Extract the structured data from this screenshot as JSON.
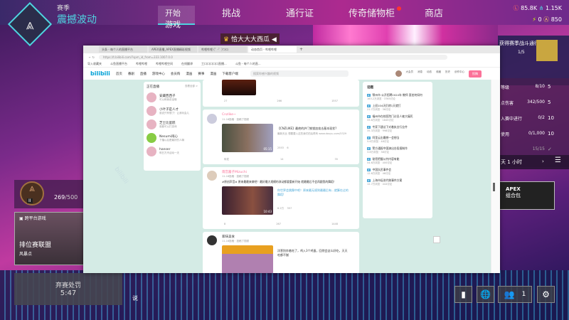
{
  "game": {
    "season_label": "赛季",
    "season_name": "震撼波动",
    "nav": [
      "开始游戏",
      "挑战",
      "通行证",
      "传奇储物柜",
      "商店"
    ],
    "currency": {
      "legend_tokens": "85.8K",
      "crafting": "1.15K",
      "apex_coins": "0",
      "gold": "850"
    },
    "player_name": "恰大大大西瓜",
    "battlepass": {
      "title": "获得赛季战斗通行证",
      "progress": "1/5"
    },
    "challenges": [
      {
        "label": "等级",
        "value": "8/10",
        "reward": "5"
      },
      {
        "label": "点伤害",
        "value": "342/500",
        "reward": "5"
      },
      {
        "label": "入赛中进行",
        "value": "0/2",
        "reward": "10"
      },
      {
        "label": "使用",
        "value": "0/1,000",
        "reward": "10"
      },
      {
        "label": "",
        "value": "15/15",
        "reward": "✓"
      }
    ],
    "challenge_timer": "天 1 小时",
    "promo": {
      "title": "APEX",
      "subtitle": "组合包"
    },
    "rank": {
      "tier": "II",
      "points": "269",
      "max": "/500"
    },
    "mode": {
      "tag": "跨平台游戏",
      "name": "排位赛联盟",
      "map": "风暴点"
    },
    "penalty": {
      "label": "弃赛处罚",
      "timer": "5:47"
    },
    "chat_label": "说",
    "party_count": "1"
  },
  "browser": {
    "tabs": [
      "头条 - 每个人的直播平台",
      "APEX直播_APEX直播精彩视频",
      "哔哩哔哩 (゜-゜)つロ",
      "动态首页 - 哔哩哔哩"
    ],
    "url": "https://t.bilibili.com/?spm_id_from=333.1007.0.0",
    "bookmarks": [
      "导入收藏夹",
      "斗鱼直播平台",
      "哔哩哔哩",
      "哔哩哔哩空间",
      "在线翻译",
      "工口口口口口直播...",
      "斗鱼 - 每个人的直..."
    ],
    "header": {
      "logo": "bilibili",
      "nav": [
        "首页",
        "番剧",
        "直播",
        "游戏中心",
        "会员购",
        "漫画",
        "赛事",
        "漫画"
      ],
      "download": "下载客户端",
      "search_placeholder": "搜索你感兴趣的视频",
      "icons": [
        "大会员",
        "消息",
        "动态",
        "收藏",
        "历史",
        "创作中心"
      ],
      "upload": "投稿"
    },
    "live": {
      "title": "正在直播",
      "more": "查看全部 >",
      "items": [
        {
          "name": "安藏西西子",
          "desc": "可以和我说话哦"
        },
        {
          "name": "小叶子是人才",
          "desc": "谁说只有想了！让我玩会儿"
        },
        {
          "name": "芝士比蛋糕",
          "desc": "谁都可以打游戏"
        },
        {
          "name": "Nesumi闹心",
          "desc": "下播以后是最好的人嘛"
        },
        {
          "name": "hanser",
          "desc": "明日方舟活动一天"
        }
      ]
    },
    "posts": [
      {
        "stats": [
          "27",
          "266",
          "1557"
        ]
      },
      {
        "author": "Cnzlike~",
        "meta": "11-16投稿 · 投稿了视频",
        "title": "【CNZLIKE】最绝的护门铁锁加攻击基本现状?",
        "desc": "最新天比 想要要入这些我们的后再有 www.douyu.com/5329",
        "duration": "05:15",
        "views": "2553",
        "danmaku": "6",
        "stats": [
          "转发",
          "14",
          "35"
        ]
      },
      {
        "author": "雨宫酱子Mizuchi",
        "meta": "11-16投稿 · 投稿了视频",
        "text": "#原创声音# 原来最最来做吧！最好最大规模的改动都要重新开始 就最最后不会再跟我的舞蹈！",
        "title": "你世界会跳舞中吧！原来最无规则最最后有...就算在过的舞蹈!",
        "duration": "10:43",
        "views": "6.2万",
        "danmaku": "357",
        "stats": [
          "8",
          "267",
          "1448"
        ]
      },
      {
        "author": "家味美食",
        "meta": "11-16投稿 · 投稿了视频",
        "title": "洋葱别炸着吃了，鸡入3个鸡蛋，回然会这么好吃，天天吃都不腻"
      }
    ],
    "topics": {
      "title": "话题",
      "items": [
        {
          "t": "鄂州市 公开招聘2024年 教师 直拍何如何",
          "m": "163.2万浏览 · 3765讨论"
        },
        {
          "t": "上班104天仍除1天就打",
          "m": "21.7万浏览 · 36讨论"
        },
        {
          "t": "福州市在校医院门诊员人被大痛死",
          "m": "33.6万浏览 · 1845讨论"
        },
        {
          "t": "专家下建议下对着执业行业件",
          "m": "35.3万浏览 · 998讨论"
        },
        {
          "t": "阿里云出最想一会想当",
          "m": "5.6万浏览 · 48讨论"
        },
        {
          "t": "警方通报中国演出台段报制作",
          "m": "3.8万浏览 · 38讨论"
        },
        {
          "t": "秘密把握公共内容有能",
          "m": "54.6万浏览 · 400讨论"
        },
        {
          "t": "中国队民事件会",
          "m": "12.6万浏览 · 46讨论"
        },
        {
          "t": "上海市促进代做事件方案",
          "m": "12.7万浏览 · 444讨论"
        }
      ]
    }
  },
  "colors": {
    "accent": "#4fd3e0",
    "bili_pink": "#fb7299",
    "bili_blue": "#00a1d6",
    "bg_teal": "#d4ebe5"
  }
}
